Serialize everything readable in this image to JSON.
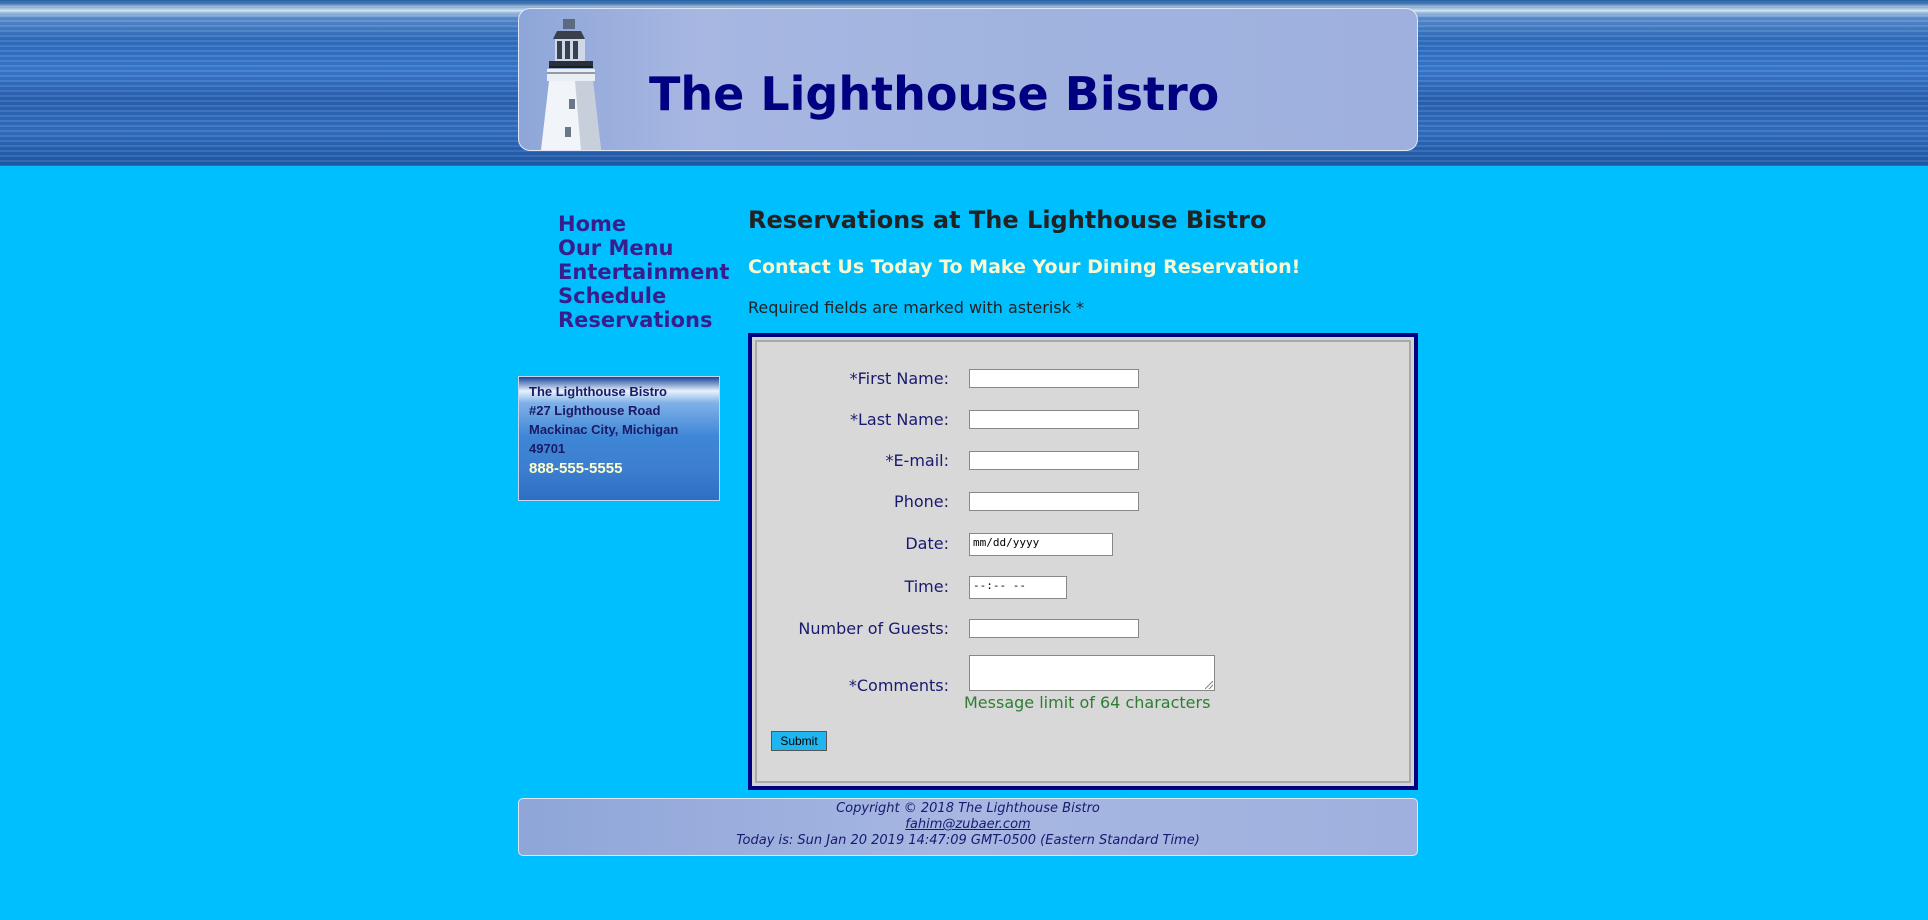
{
  "header": {
    "title": "The Lighthouse Bistro"
  },
  "nav": {
    "items": [
      "Home",
      "Our Menu",
      "Entertainment",
      "Schedule",
      "Reservations"
    ]
  },
  "address": {
    "name": "The Lighthouse Bistro",
    "street": "#27 Lighthouse Road",
    "city": "Mackinac City, Michigan",
    "zip": "49701",
    "phone": "888-555-5555"
  },
  "main": {
    "heading": "Reservations at The Lighthouse Bistro",
    "subheading": "Contact Us Today To Make Your Dining Reservation!",
    "required_note": "Required fields are marked with asterisk *"
  },
  "form": {
    "first_name_label": "*First Name:",
    "last_name_label": "*Last Name:",
    "email_label": "*E-mail:",
    "phone_label": "Phone:",
    "date_label": "Date:",
    "date_placeholder": "mm/dd/yyyy",
    "time_label": "Time:",
    "time_placeholder": "--:-- --",
    "guests_label": "Number of Guests:",
    "comments_label": "*Comments:",
    "message_limit": "Message limit of 64 characters",
    "submit_label": "Submit"
  },
  "footer": {
    "copyright": "Copyright © 2018 The Lighthouse Bistro",
    "email": "fahim@zubaer.com",
    "today": "Today is: Sun Jan 20 2019 14:47:09 GMT-0500 (Eastern Standard Time)"
  },
  "colors": {
    "page_background": "#00bfff",
    "title_color": "#000080",
    "nav_color": "#3a1d8c",
    "form_border": "#000080",
    "subheading_color": "#fafad2",
    "limit_color": "#2e7d32"
  }
}
